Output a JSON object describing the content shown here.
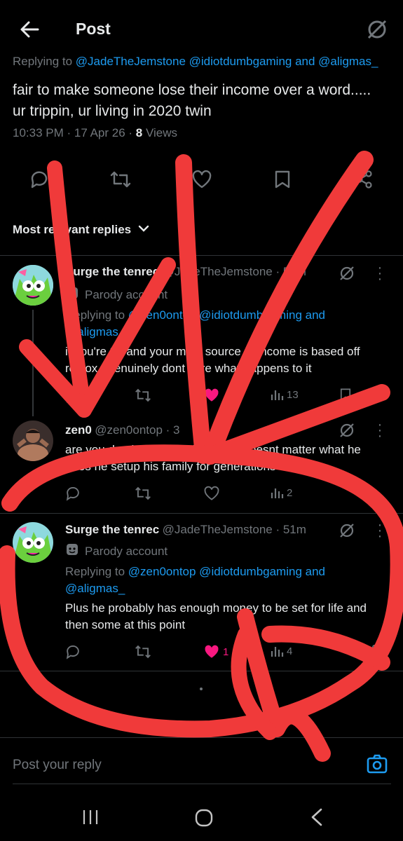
{
  "header": {
    "title": "Post"
  },
  "post": {
    "replying_prefix": "Replying to",
    "replying_users": "@JadeTheJemstone @idiotdumbgaming and @aligmas_",
    "text": "fair to make someone lose their income over a word..... ur trippin, ur living in 2020 twin",
    "timestamp": "10:33 PM · 17 Apr 26 ·",
    "views_count": "8",
    "views_label": "Views"
  },
  "sort": {
    "label": "Most relevant replies"
  },
  "replies": [
    {
      "name": "Surge the tenrec",
      "handle": "@JadeTheJemstone · 51m",
      "badge": "Parody account",
      "replying_prefix": "Replying to",
      "replying_users": "@zen0ontop @idiotdumbgaming and @aligmas_",
      "text": "if you're 30 and your main source of income is based off roblox I genuinely dont care what happens to it",
      "views": "13"
    },
    {
      "name": "zen0",
      "handle": "@zen0ontop · 3",
      "text": "are you dumb? he's a millionaire, doesnt matter what he does he setup his family for generations",
      "views": "2"
    },
    {
      "name": "Surge the tenrec",
      "handle": "@JadeTheJemstone · 51m",
      "badge": "Parody account",
      "replying_prefix": "Replying to",
      "replying_users": "@zen0ontop @idiotdumbgaming and @aligmas_",
      "text": "Plus he probably has enough money to be set for life and then some at this point",
      "likes": "1",
      "views": "4"
    }
  ],
  "composer": {
    "placeholder": "Post your reply"
  },
  "colors": {
    "accent": "#1d9bf0",
    "like": "#f91880",
    "annotation": "#f03a3a",
    "background": "#000000"
  }
}
